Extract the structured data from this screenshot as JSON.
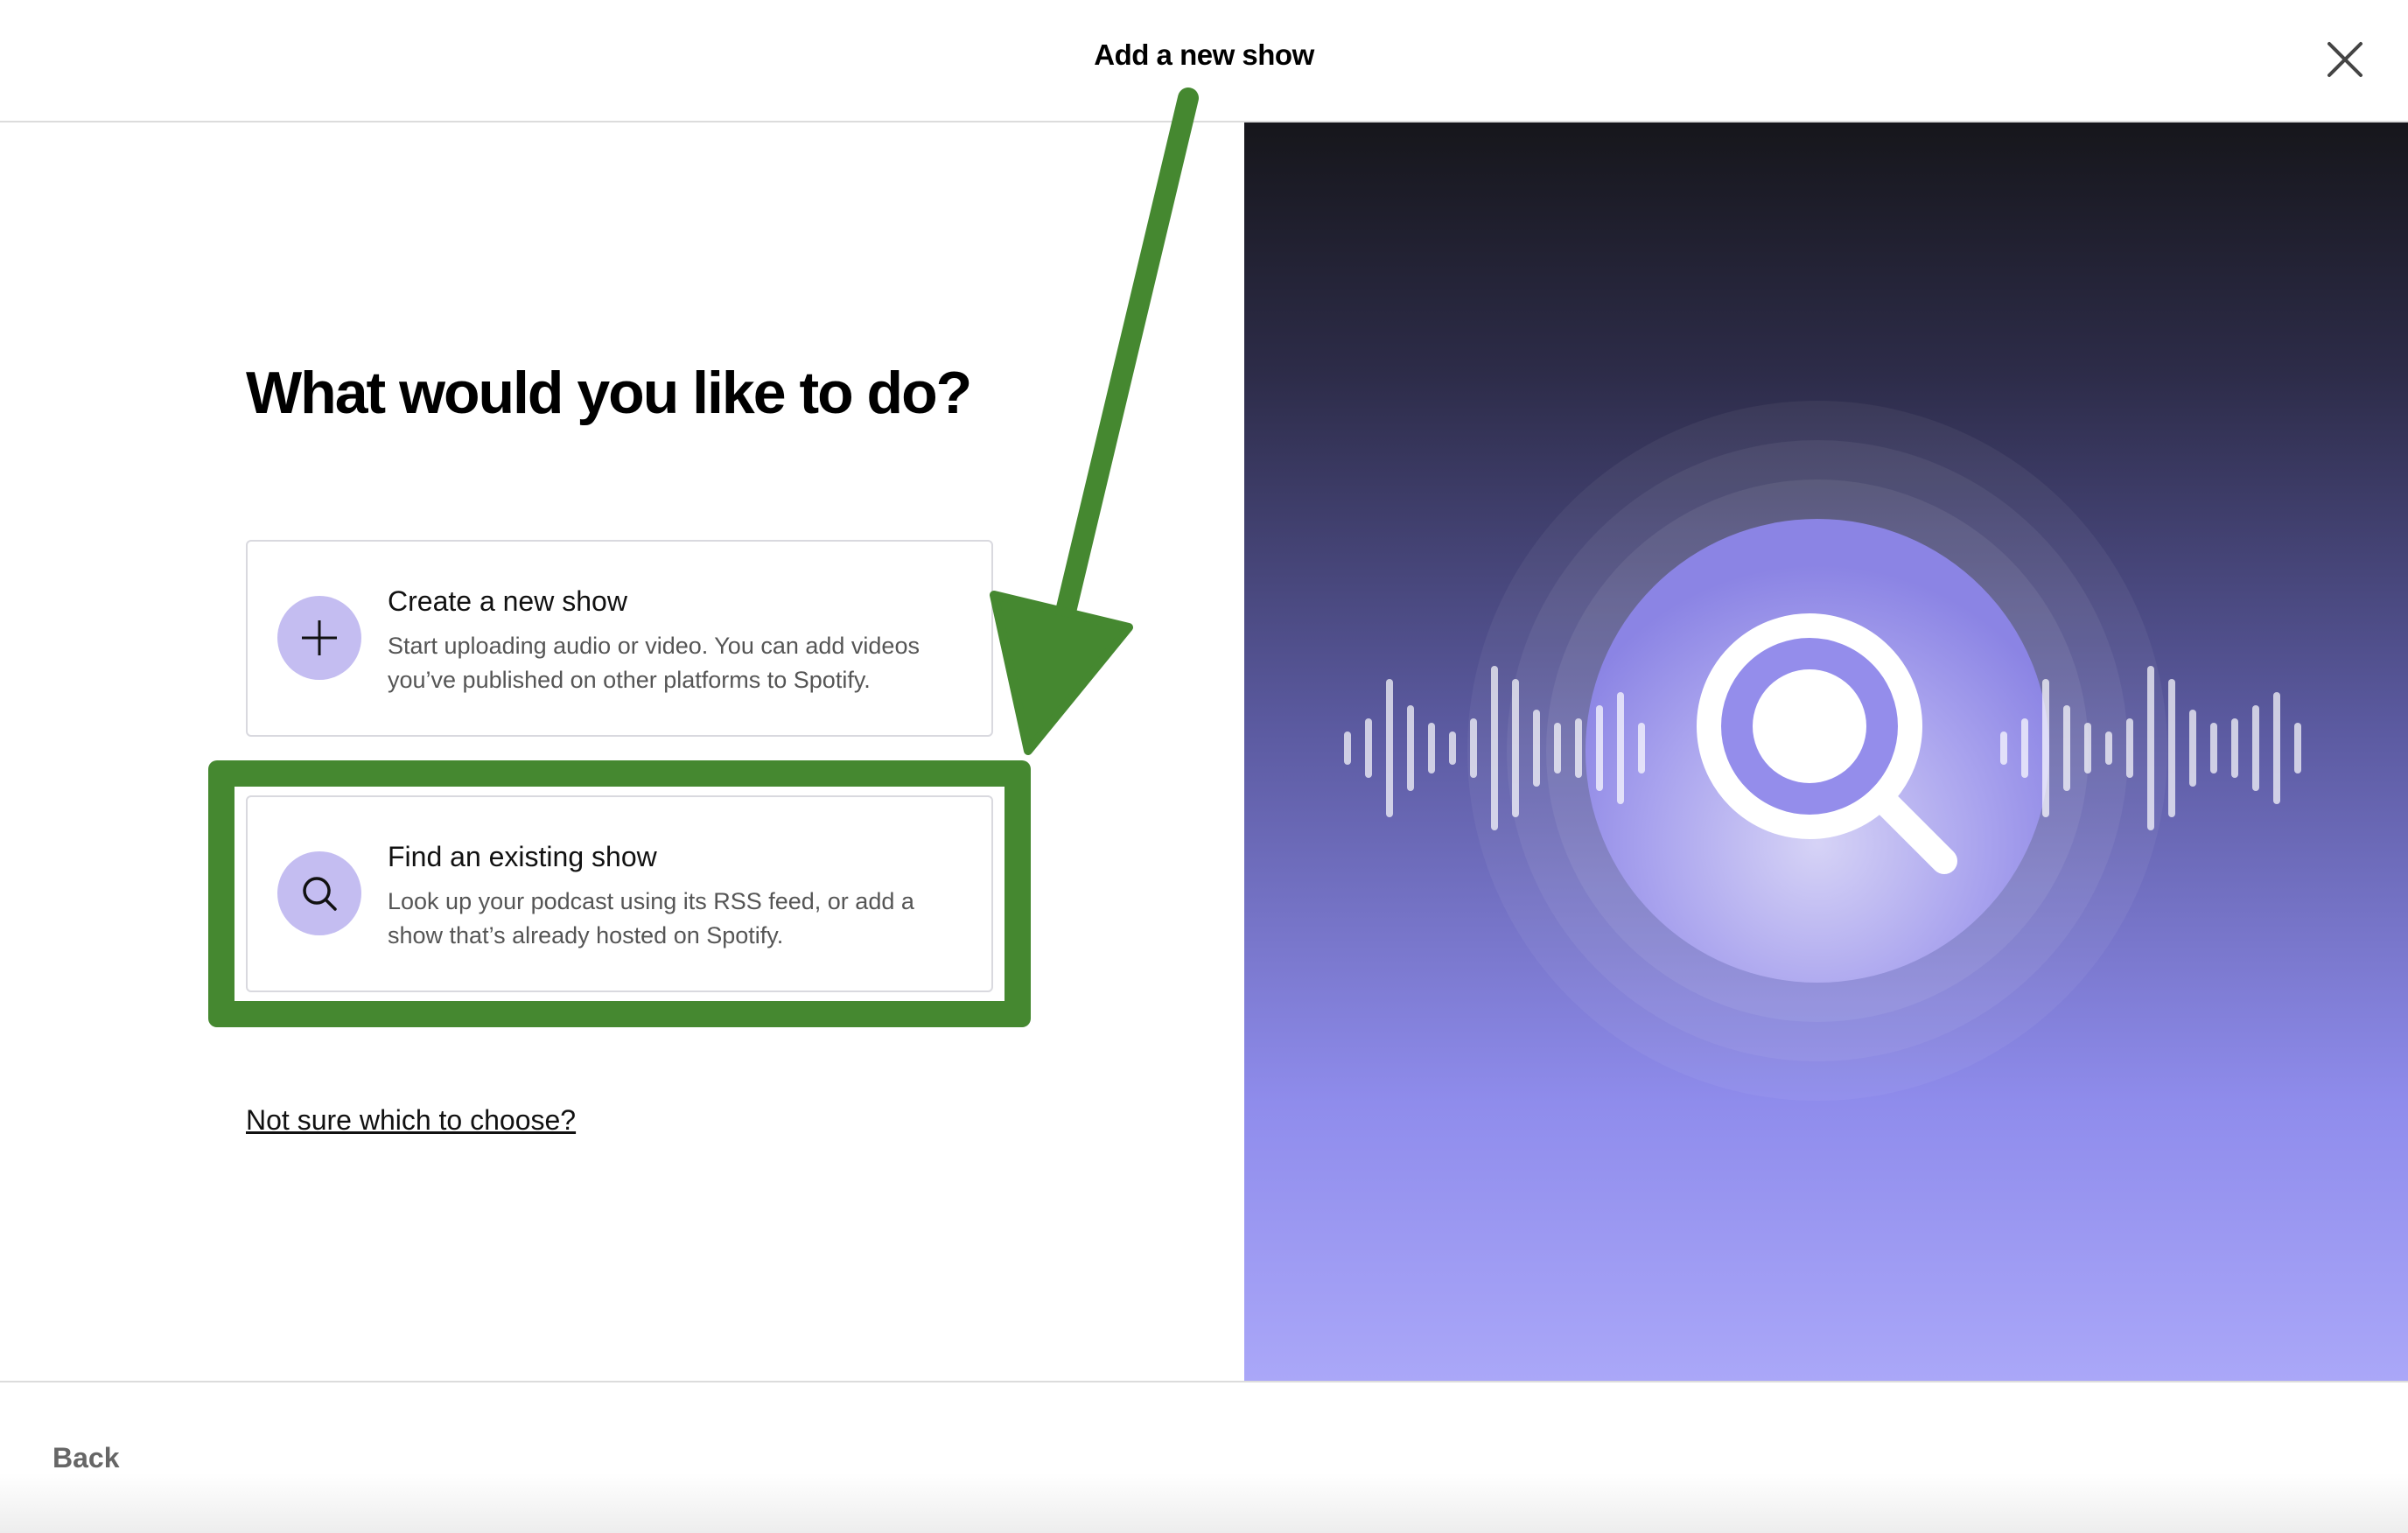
{
  "header": {
    "title": "Add a new show",
    "close_icon": "close-icon"
  },
  "main": {
    "heading": "What would you like to do?",
    "options": [
      {
        "title": "Create a new show",
        "description": "Start uploading audio or video. You can add videos you’ve published on other platforms to Spotify.",
        "icon": "plus-icon"
      },
      {
        "title": "Find an existing show",
        "description": "Look up your podcast using its RSS feed, or add a show that’s already hosted on Spotify.",
        "icon": "search-icon"
      }
    ],
    "help_link": "Not sure which to choose?"
  },
  "illustration": {
    "icon": "magnifier-soundwave-illustration"
  },
  "annotation": {
    "color": "#458830",
    "highlighted_option": "Find an existing show"
  },
  "footer": {
    "back_label": "Back"
  },
  "colors": {
    "icon_circle": "#c4bdf1",
    "gradient_top": "#16161b",
    "gradient_bottom": "#aaa7f8"
  }
}
